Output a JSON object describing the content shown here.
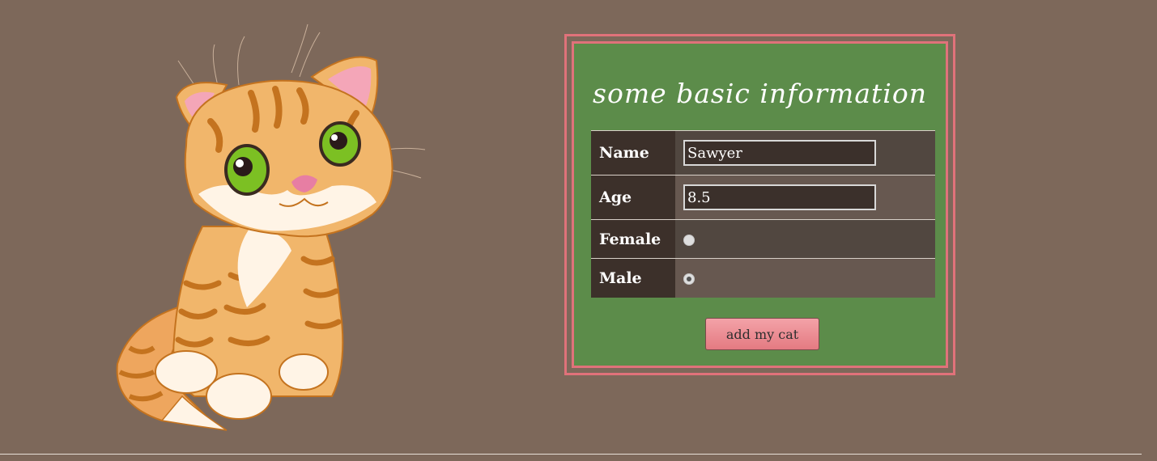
{
  "form": {
    "title": "some basic information",
    "fields": {
      "name": {
        "label": "Name",
        "value": "Sawyer"
      },
      "age": {
        "label": "Age",
        "value": "8.5"
      },
      "female": {
        "label": "Female",
        "checked": false
      },
      "male": {
        "label": "Male",
        "checked": true
      }
    },
    "submit_label": "add my cat"
  },
  "colors": {
    "background": "#7d685a",
    "panel_green": "#5c8c4a",
    "frame_pink": "#e0727a",
    "button_pink": "#ea8d94"
  },
  "illustration": {
    "icon": "orange-tabby-kitten-illustration"
  }
}
